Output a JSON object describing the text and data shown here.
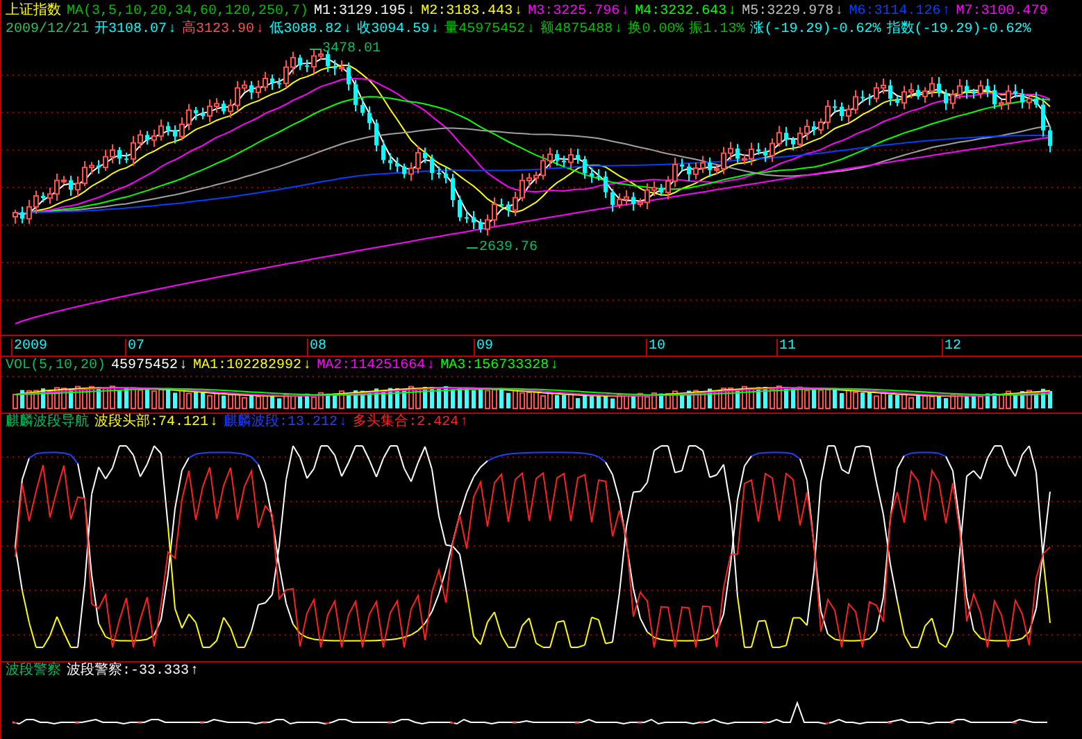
{
  "header": {
    "title": "上证指数",
    "ma_label": "MA(3,5,10,20,34,60,120,250,7)",
    "ma_values": [
      {
        "text": "M1:3129.195",
        "arrow": "↓",
        "color": "#ffffff"
      },
      {
        "text": "M2:3183.443",
        "arrow": "↓",
        "color": "#ffff00"
      },
      {
        "text": "M3:3225.796",
        "arrow": "↓",
        "color": "#ff00ff"
      },
      {
        "text": "M4:3232.643",
        "arrow": "↓",
        "color": "#00ff00"
      },
      {
        "text": "M5:3229.978",
        "arrow": "↓",
        "color": "#c0c0c0"
      },
      {
        "text": "M6:3114.126",
        "arrow": "↑",
        "color": "#0040ff"
      },
      {
        "text": "M7:3100.479",
        "color": "#ff00ff"
      }
    ],
    "date": "2009/12/21",
    "quotes": [
      {
        "text": "开3108.07",
        "arrow": "↓",
        "color": "#00ffff"
      },
      {
        "text": "高3123.90",
        "arrow": "↓",
        "color": "#ff5050"
      },
      {
        "text": "低3088.82",
        "arrow": "↓",
        "color": "#00ffff"
      },
      {
        "text": "收3094.59",
        "arrow": "↓",
        "color": "#00ffff"
      },
      {
        "text": "量45975452",
        "arrow": "↓",
        "color": "#00c000"
      },
      {
        "text": "额4875488",
        "arrow": "↓",
        "color": "#00c000"
      },
      {
        "text": "换0.00%",
        "color": "#00c000"
      },
      {
        "text": "振1.13%",
        "color": "#00c000"
      },
      {
        "text": "涨(-19.29)-0.62%",
        "color": "#00ffff"
      },
      {
        "text": "指数(-19.29)-0.62%",
        "color": "#00ffff"
      }
    ]
  },
  "main_chart": {
    "annotations": [
      {
        "text": "3478.01"
      },
      {
        "text": "2639.76"
      }
    ],
    "x_labels": [
      "2009",
      "07",
      "08",
      "09",
      "10",
      "11",
      "12"
    ]
  },
  "volume": {
    "label": "VOL(5,10,20)",
    "values": [
      {
        "text": "45975452",
        "arrow": "↓",
        "color": "#ffffff"
      },
      {
        "text": "MA1:102282992",
        "arrow": "↓",
        "color": "#ffff00"
      },
      {
        "text": "MA2:114251664",
        "arrow": "↓",
        "color": "#ff00ff"
      },
      {
        "text": "MA3:156733328",
        "arrow": "↓",
        "color": "#00ff00"
      }
    ]
  },
  "indicator": {
    "label": "麒麟波段导航",
    "values": [
      {
        "text": "波段头部:74.121",
        "arrow": "↓",
        "color": "#ffff00"
      },
      {
        "text": "麒麟波段:13.212",
        "arrow": "↓",
        "color": "#2040ff"
      },
      {
        "text": "多头集合:2.424",
        "arrow": "↑",
        "color": "#ff2020"
      }
    ]
  },
  "police": {
    "label": "波段警察",
    "values": [
      {
        "text": "波段警察:-33.333",
        "arrow": "↑",
        "color": "#ffffff"
      }
    ]
  }
}
